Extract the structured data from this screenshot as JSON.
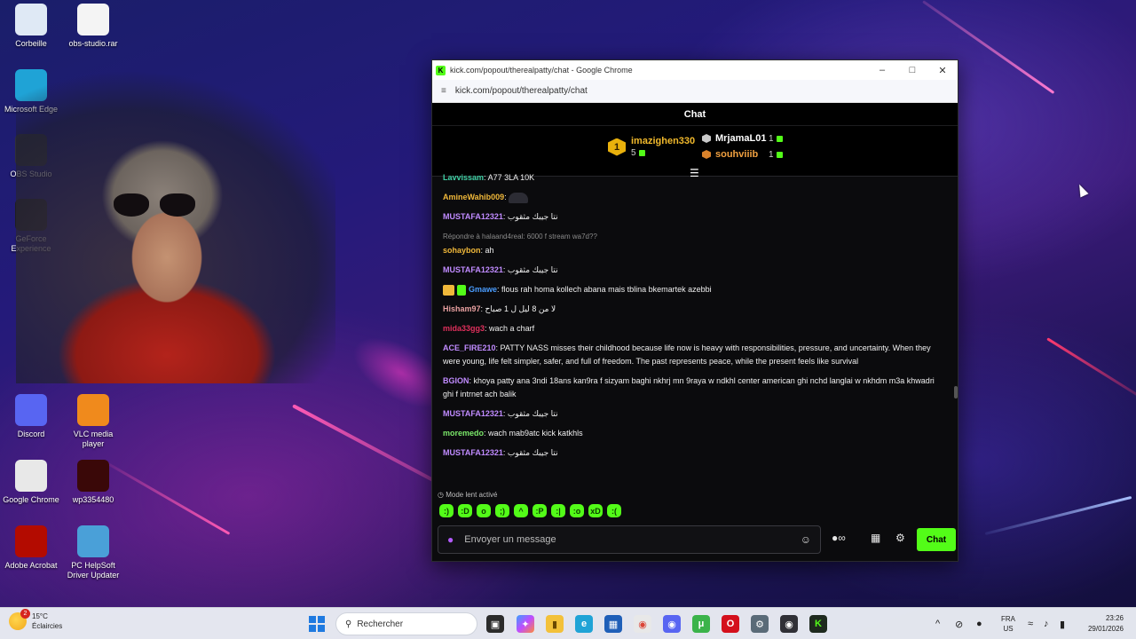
{
  "desktop": {
    "icons": [
      {
        "label": "Corbeille",
        "icon": "recycle-bin-icon",
        "color": "#dfe9f5"
      },
      {
        "label": "obs-studio.rar",
        "icon": "archive-file-icon",
        "color": "#f4f4f4"
      },
      {
        "label": "Microsoft Edge",
        "icon": "edge-icon",
        "color": "#1fa3d6"
      },
      {
        "label": "OBS Studio",
        "icon": "obs-icon",
        "color": "#303036"
      },
      {
        "label": "GeForce Experience",
        "icon": "nvidia-icon",
        "color": "#1f1f1f"
      },
      {
        "label": "Discord",
        "icon": "discord-icon",
        "color": "#5865f2"
      },
      {
        "label": "VLC media player",
        "icon": "vlc-icon",
        "color": "#f08a1c"
      },
      {
        "label": "Google Chrome",
        "icon": "chrome-icon",
        "color": "#e8e8e8"
      },
      {
        "label": "wp3354480",
        "icon": "image-file-icon",
        "color": "#3a0808"
      },
      {
        "label": "Adobe Acrobat",
        "icon": "acrobat-icon",
        "color": "#b30b00"
      },
      {
        "label": "PC HelpSoft Driver Updater",
        "icon": "driver-updater-icon",
        "color": "#4aa0d8"
      }
    ]
  },
  "window": {
    "title": "kick.com/popout/therealpatty/chat - Google Chrome",
    "favicon": "K",
    "url": "kick.com/popout/therealpatty/chat"
  },
  "chat": {
    "header": "Chat",
    "leaderboard": {
      "first": {
        "rank": "1",
        "name": "imazighen330",
        "count": "5"
      },
      "second": {
        "name": "MrjamaL01",
        "count": "1"
      },
      "third": {
        "name": "souhviiib",
        "count": "1"
      }
    },
    "messages": [
      {
        "user": "Lavvissam",
        "user_color": "#3fd0a4",
        "text": "A77 3LA 10K"
      },
      {
        "user": "AmineWahib009",
        "user_color": "#f0b83a",
        "text": ""
      },
      {
        "user": "MUSTAFA12321",
        "user_color": "#c08bff",
        "text": "نتا جيبك مثقوب"
      },
      {
        "reply": "Répondre à halaand4real: 6000 f stream wa7d??",
        "user": "sohaybon",
        "user_color": "#f0b83a",
        "text": "ah"
      },
      {
        "user": "MUSTAFA12321",
        "user_color": "#c08bff",
        "text": "نتا جيبك مثقوب"
      },
      {
        "user": "Gmawe",
        "user_color": "#4a9dff",
        "text": "flous rah homa kollech abana mais tblina bkemartek azebbi",
        "badges": true
      },
      {
        "user": "Hisham97",
        "user_color": "#e8a0a0",
        "text": "لا من 8 ليل ل 1 صباح"
      },
      {
        "user": "mida33gg3",
        "user_color": "#e0305c",
        "text": "wach a charf"
      },
      {
        "user": "ACE_FIRE210",
        "user_color": "#c08bff",
        "text": "PATTY NASS misses their childhood because life now is heavy with responsibilities, pressure, and uncertainty. When they were young, life felt simpler, safer, and full of freedom. The past represents peace, while the present feels like survival"
      },
      {
        "user": "BGION",
        "user_color": "#c08bff",
        "text": "khoya patty ana 3ndi 18ans kan9ra f sizyam baghi nkhrj mn 9raya w ndkhl center american ghi nchd langlai w nkhdm m3a khwadri ghi f intrnet ach balik"
      },
      {
        "user": "MUSTAFA12321",
        "user_color": "#c08bff",
        "text": "نتا جيبك مثقوب"
      },
      {
        "user": "moremedo",
        "user_color": "#7be86a",
        "text": "wach mab9atc kick katkhls"
      },
      {
        "user": "MUSTAFA12321",
        "user_color": "#c08bff",
        "text": "نتا جيبك مثقوب"
      }
    ],
    "slow_mode": "Mode lent activé",
    "input_placeholder": "Envoyer un message",
    "send_label": "Chat"
  },
  "taskbar": {
    "weather_temp": "15°C",
    "weather_desc": "Éclaircies",
    "weather_badge": "2",
    "search_placeholder": "Rechercher",
    "lang_top": "FRA",
    "lang_bottom": "US",
    "time": "23:26",
    "date": "29/01/2026"
  },
  "colors": {
    "accent": "#53fc18",
    "gold": "#e9b10c"
  }
}
